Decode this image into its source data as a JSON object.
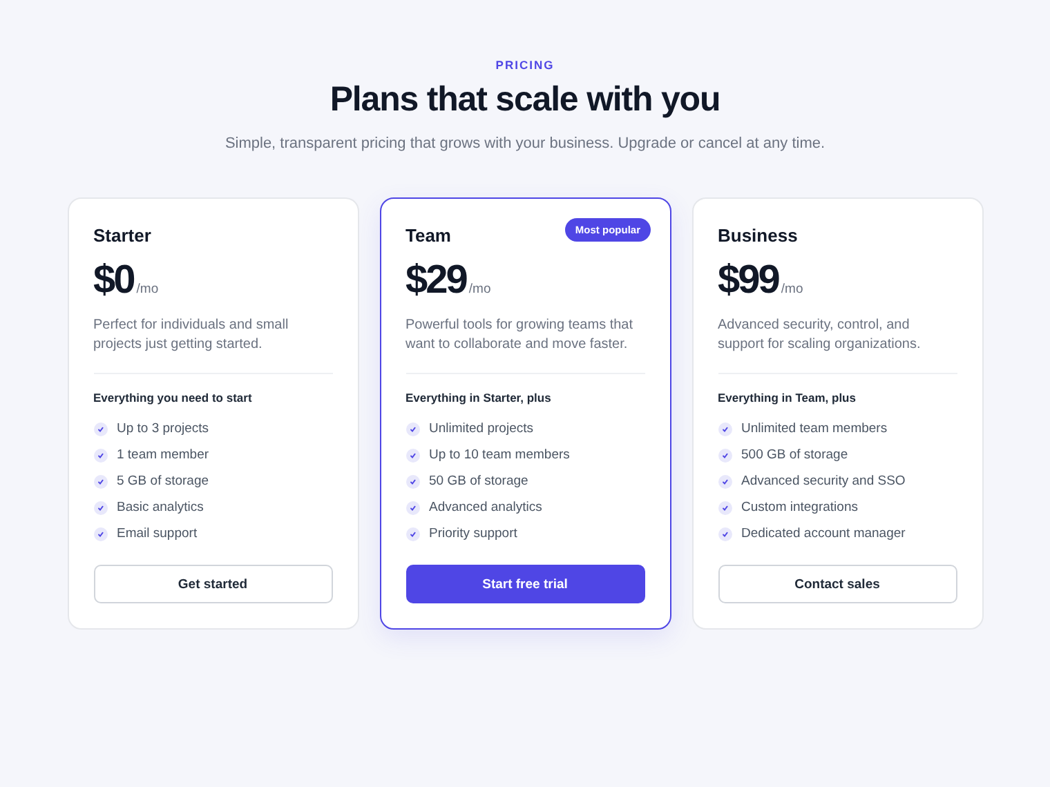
{
  "header": {
    "eyebrow": "PRICING",
    "title": "Plans that scale with you",
    "subtitle": "Simple, transparent pricing that grows with your business. Upgrade or cancel at any time."
  },
  "plans": [
    {
      "name": "Starter",
      "price": "$0",
      "period": "/mo",
      "description": "Perfect for individuals and small projects just getting started.",
      "features_heading": "Everything you need to start",
      "features": [
        "Up to 3 projects",
        "1 team member",
        "5 GB of storage",
        "Basic analytics",
        "Email support"
      ],
      "button": "Get started",
      "highlighted": false
    },
    {
      "name": "Team",
      "badge": "Most popular",
      "price": "$29",
      "period": "/mo",
      "description": "Powerful tools for growing teams that want to collaborate and move faster.",
      "features_heading": "Everything in Starter, plus",
      "features": [
        "Unlimited projects",
        "Up to 10 team members",
        "50 GB of storage",
        "Advanced analytics",
        "Priority support"
      ],
      "button": "Start free trial",
      "highlighted": true
    },
    {
      "name": "Business",
      "price": "$99",
      "period": "/mo",
      "description": "Advanced security, control, and support for scaling organizations.",
      "features_heading": "Everything in Team, plus",
      "features": [
        "Unlimited team members",
        "500 GB of storage",
        "Advanced security and SSO",
        "Custom integrations",
        "Dedicated account manager"
      ],
      "button": "Contact sales",
      "highlighted": false
    }
  ]
}
